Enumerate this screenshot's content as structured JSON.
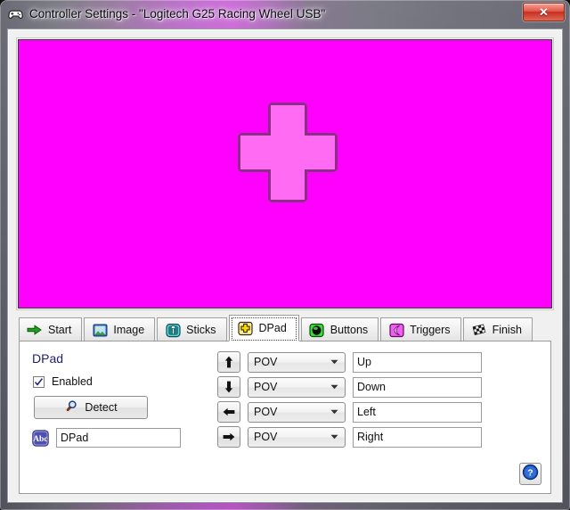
{
  "window": {
    "title": "Controller Settings - \"Logitech G25 Racing Wheel USB\"",
    "icon": "gamepad-icon",
    "close_label": "✕"
  },
  "preview": {
    "background_color": "#ff00ff",
    "shape": "dpad-cross",
    "shape_fill": "#ff6bf2",
    "shape_border": "#8a2f86"
  },
  "tabs": [
    {
      "label": "Start",
      "icon": "green-arrow-icon",
      "selected": false
    },
    {
      "label": "Image",
      "icon": "picture-icon",
      "selected": false
    },
    {
      "label": "Sticks",
      "icon": "joystick-icon",
      "selected": false
    },
    {
      "label": "DPad",
      "icon": "yellow-cross-icon",
      "selected": true
    },
    {
      "label": "Buttons",
      "icon": "green-button-icon",
      "selected": false
    },
    {
      "label": "Triggers",
      "icon": "magenta-trigger-icon",
      "selected": false
    },
    {
      "label": "Finish",
      "icon": "checkered-flag-icon",
      "selected": false
    }
  ],
  "panel": {
    "section_title": "DPad",
    "enabled_label": "Enabled",
    "enabled_checked": true,
    "detect_label": "Detect",
    "detect_icon": "magnifier-icon",
    "name_icon": "abc-icon",
    "name_value": "DPad",
    "name_placeholder": "",
    "help_icon": "question-help-icon"
  },
  "mappings": [
    {
      "direction_icon": "arrow-up-icon",
      "source": "POV",
      "name": "Up"
    },
    {
      "direction_icon": "arrow-down-icon",
      "source": "POV",
      "name": "Down"
    },
    {
      "direction_icon": "arrow-left-icon",
      "source": "POV",
      "name": "Left"
    },
    {
      "direction_icon": "arrow-right-icon",
      "source": "POV",
      "name": "Right"
    }
  ],
  "source_options": [
    "POV"
  ],
  "colors": {
    "accent_magenta": "#ff00ff",
    "title_text": "#0b0b11",
    "section_title": "#1f1f6e",
    "close_red": "#c62f21"
  }
}
